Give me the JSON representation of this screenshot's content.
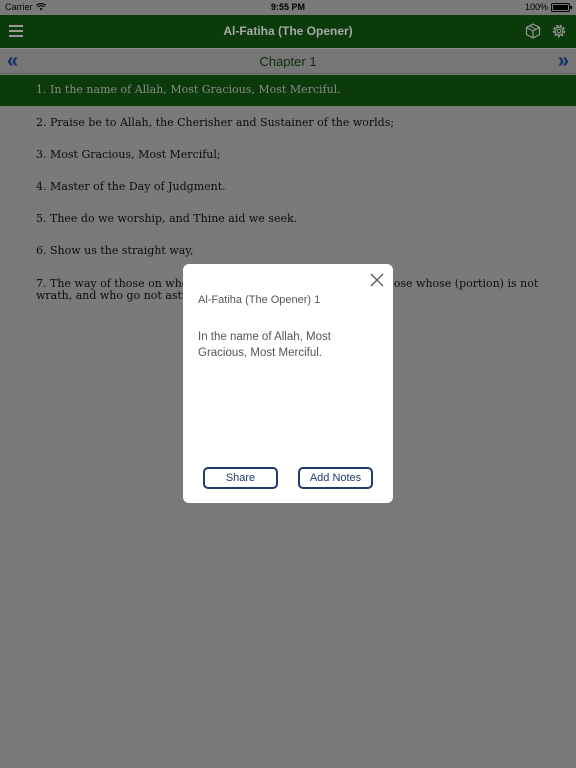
{
  "status_bar": {
    "carrier": "Carrier",
    "time": "9:55 PM",
    "battery": "100%"
  },
  "nav": {
    "title": "Al-Fatiha (The Opener)",
    "menu_icon": "hamburger-icon",
    "cube_icon": "cube-icon",
    "settings_icon": "gear-icon"
  },
  "chapter": {
    "title": "Chapter 1",
    "prev": "«",
    "next": "»"
  },
  "verses": [
    "1. In the name of Allah, Most Gracious, Most Merciful.",
    "2. Praise be to Allah, the Cherisher and Sustainer of the worlds;",
    "3. Most Gracious, Most Merciful;",
    "4. Master of the Day of Judgment.",
    "5. Thee do we worship, and Thine aid we seek.",
    "6. Show us the straight way,",
    "7. The way of those on whom Thou hast bestowed Thy Grace, those whose (portion) is not wrath, and who go not astray."
  ],
  "dialog": {
    "title": "Al-Fatiha (The Opener) 1",
    "body": "In the name of Allah, Most Gracious, Most Merciful.",
    "share_label": "Share",
    "add_notes_label": "Add Notes"
  },
  "colors": {
    "nav_green": "#0b3a0b",
    "overlay_gray": "#7a7a7a",
    "button_blue": "#1f3a6b"
  }
}
